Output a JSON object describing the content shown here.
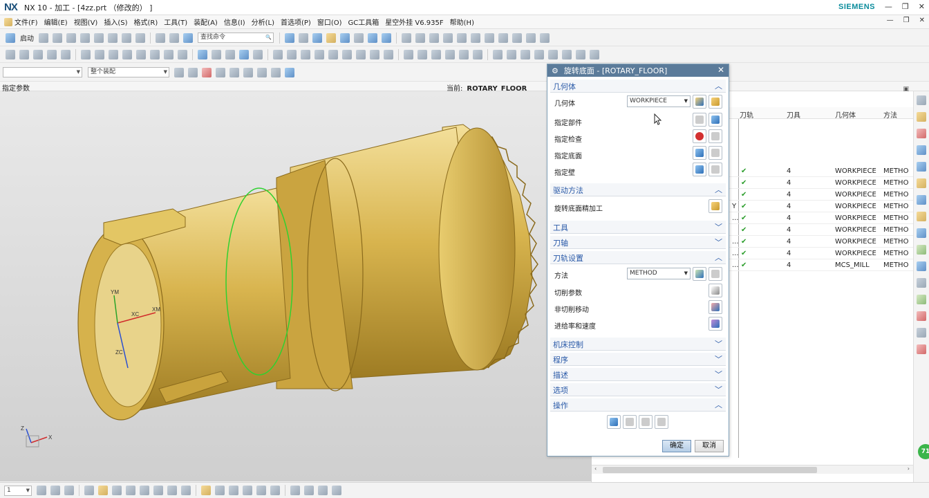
{
  "window": {
    "logo": "NX",
    "title": "NX 10 - 加工 - [4zz.prt （修改的） ]",
    "brand": "SIEMENS",
    "min": "—",
    "restore": "❐",
    "close": "✕"
  },
  "menu": [
    "文件(F)",
    "编辑(E)",
    "视图(V)",
    "插入(S)",
    "格式(R)",
    "工具(T)",
    "装配(A)",
    "信息(I)",
    "分析(L)",
    "首选项(P)",
    "窗口(O)",
    "GC工具箱",
    "星空外挂 V6.935F",
    "帮助(H)"
  ],
  "toolbar1": {
    "start_label": "启动",
    "command_search": "查找命令"
  },
  "toolbar3": {
    "selection_filter": "",
    "assembly_scope": "整个装配"
  },
  "status": {
    "prompt": "指定参数",
    "current_label": "当前:",
    "current_value": "ROTARY_FLOOR"
  },
  "viewport": {
    "axes": {
      "xm": "XM",
      "xc": "XC",
      "ym": "YM",
      "zc": "ZC",
      "z": "Z",
      "x": "X"
    }
  },
  "navigator": {
    "columns": [
      "刀轨",
      "刀具",
      "几何体",
      "方法"
    ],
    "rows": [
      {
        "prefix": "",
        "toolpath": "✔",
        "tool": "4",
        "geometry": "WORKPIECE",
        "method": "METHO"
      },
      {
        "prefix": "",
        "toolpath": "✔",
        "tool": "4",
        "geometry": "WORKPIECE",
        "method": "METHO"
      },
      {
        "prefix": "",
        "toolpath": "✔",
        "tool": "4",
        "geometry": "WORKPIECE",
        "method": "METHO"
      },
      {
        "prefix": "Y",
        "toolpath": "✔",
        "tool": "4",
        "geometry": "WORKPIECE",
        "method": "METHO"
      },
      {
        "prefix": "...",
        "toolpath": "✔",
        "tool": "4",
        "geometry": "WORKPIECE",
        "method": "METHO"
      },
      {
        "prefix": "",
        "toolpath": "✔",
        "tool": "4",
        "geometry": "WORKPIECE",
        "method": "METHO"
      },
      {
        "prefix": "...",
        "toolpath": "✔",
        "tool": "4",
        "geometry": "WORKPIECE",
        "method": "METHO"
      },
      {
        "prefix": "...",
        "toolpath": "✔",
        "tool": "4",
        "geometry": "WORKPIECE",
        "method": "METHO"
      },
      {
        "prefix": "...",
        "toolpath": "✔",
        "tool": "4",
        "geometry": "MCS_MILL",
        "method": "METHO"
      }
    ]
  },
  "dialog": {
    "title": "旋转底面 - [ROTARY_FLOOR]",
    "sections": {
      "geometry": {
        "label": "几何体",
        "geom_label": "几何体",
        "geom_value": "WORKPIECE",
        "part": "指定部件",
        "check": "指定检查",
        "floor": "指定底面",
        "wall": "指定壁"
      },
      "drive": {
        "label": "驱动方法",
        "method": "旋转底面精加工"
      },
      "tool": {
        "label": "工具"
      },
      "axis": {
        "label": "刀轴"
      },
      "path": {
        "label": "刀轨设置",
        "method_label": "方法",
        "method_value": "METHOD",
        "cut": "切削参数",
        "noncut": "非切削移动",
        "feeds": "进给率和速度"
      },
      "machine": {
        "label": "机床控制"
      },
      "program": {
        "label": "程序"
      },
      "desc": {
        "label": "描述"
      },
      "options": {
        "label": "选项"
      },
      "actions": {
        "label": "操作"
      }
    },
    "ok": "确定",
    "cancel": "取消"
  },
  "bottom": {
    "layer": "1"
  }
}
